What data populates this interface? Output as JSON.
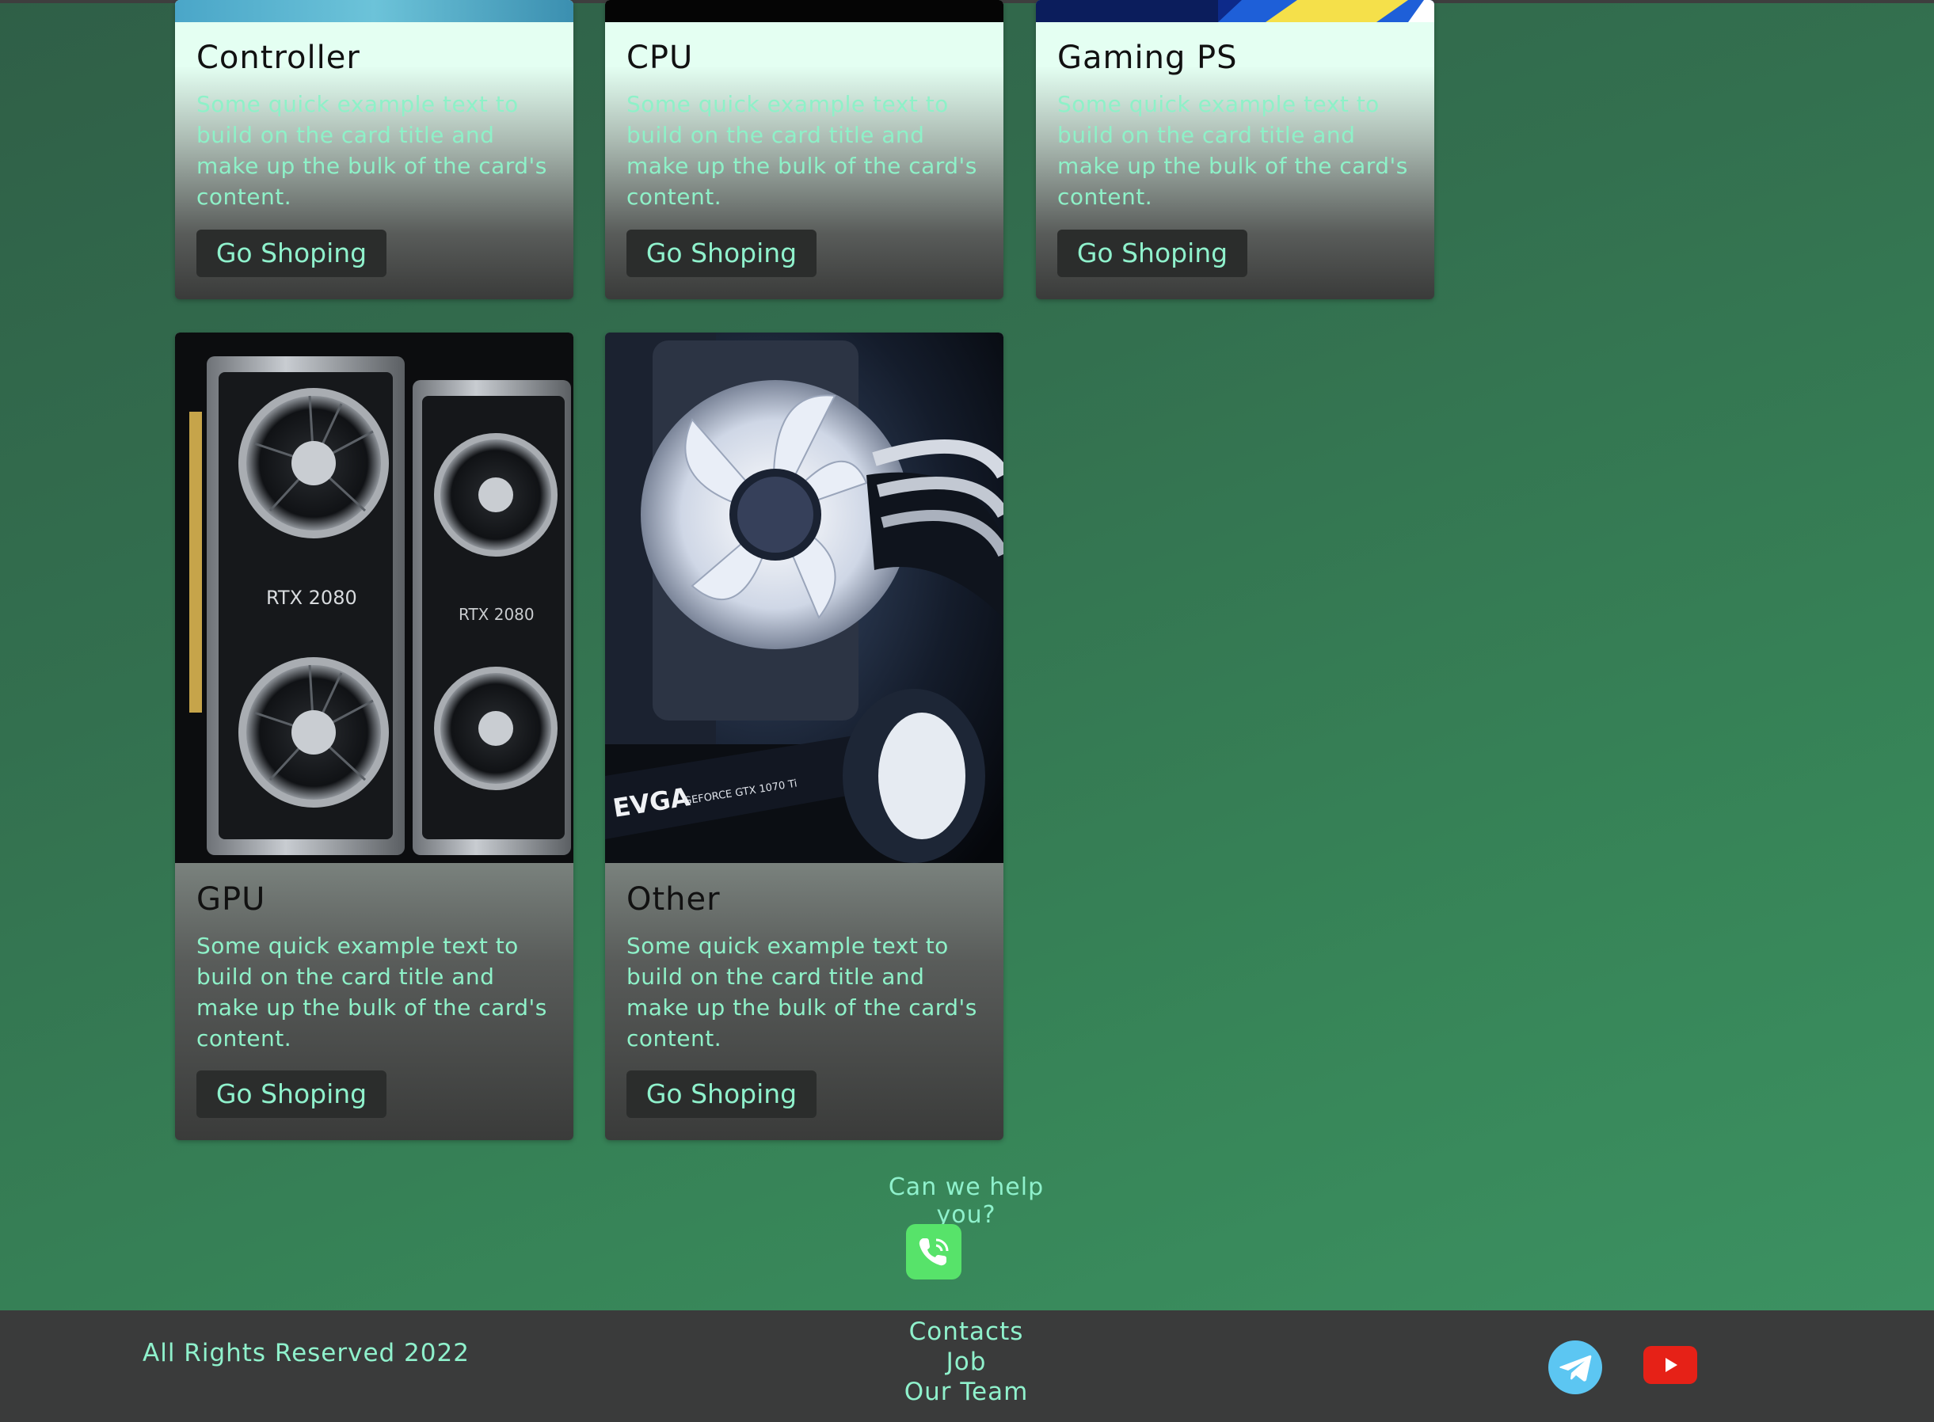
{
  "cards": [
    {
      "title": "Controller",
      "text": "Some quick example text to build on the card title and make up the bulk of the card's content.",
      "button": "Go Shoping",
      "image": "controller-photo"
    },
    {
      "title": "CPU",
      "text": "Some quick example text to build on the card title and make up the bulk of the card's content.",
      "button": "Go Shoping",
      "image": "cpu-photo"
    },
    {
      "title": "Gaming PS",
      "text": "Some quick example text to build on the card title and make up the bulk of the card's content.",
      "button": "Go Shoping",
      "image": "gaming-ps-photo"
    },
    {
      "title": "GPU",
      "text": "Some quick example text to build on the card title and make up the bulk of the card's content.",
      "button": "Go Shoping",
      "image": "gpu-photo",
      "image_label_1": "RTX 2080",
      "image_label_2": "RTX 2080"
    },
    {
      "title": "Other",
      "text": "Some quick example text to build on the card title and make up the bulk of the card's content.",
      "button": "Go Shoping",
      "image": "pc-fan-photo",
      "image_label_1": "EVGA",
      "image_label_2": "GEFORCE GTX 1070 Ti"
    }
  ],
  "help": {
    "text": "Can we help you?",
    "icon": "phone-icon",
    "icon_color": "#57e36a"
  },
  "footer": {
    "rights": "All Rights Reserved 2022",
    "links": [
      "Contacts",
      "Job",
      "Our Team"
    ],
    "social": [
      {
        "icon": "telegram-icon",
        "color": "#5cc6f2"
      },
      {
        "icon": "youtube-icon",
        "color": "#e62117"
      }
    ]
  },
  "colors": {
    "accent_text": "#8ff1cc",
    "card_top": "#e4fff2",
    "button_bg": "#2b2d2c",
    "footer_bg": "#3a3b3b"
  }
}
